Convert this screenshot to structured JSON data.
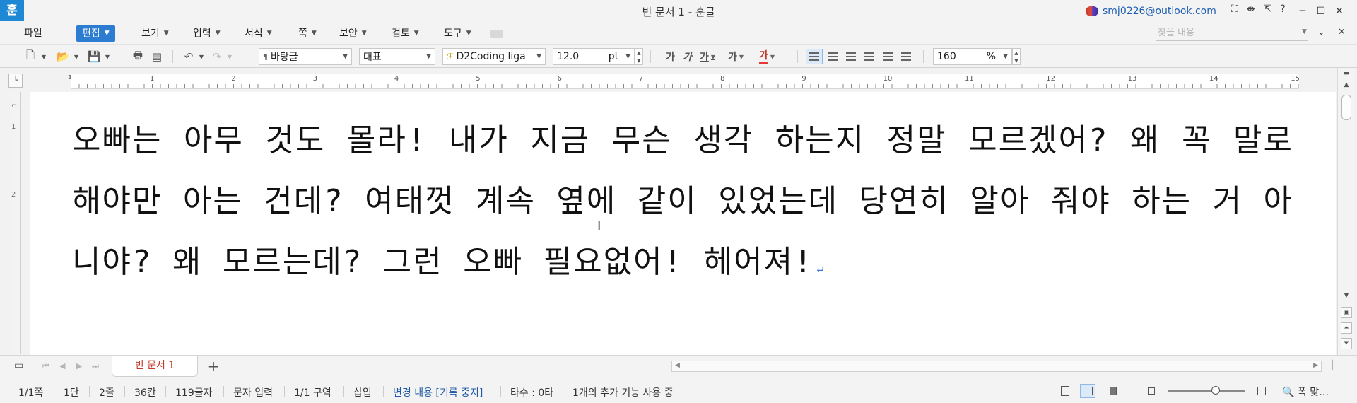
{
  "app": {
    "logo": "훈",
    "window_title": "빈 문서 1 - 훈글",
    "account_email": "smj0226@outlook.com",
    "help_label": "?"
  },
  "menu": {
    "items": [
      {
        "label": "파일",
        "has_dropdown": false
      },
      {
        "label": "편집",
        "has_dropdown": true,
        "active": true
      },
      {
        "label": "보기",
        "has_dropdown": true
      },
      {
        "label": "입력",
        "has_dropdown": true
      },
      {
        "label": "서식",
        "has_dropdown": true
      },
      {
        "label": "쪽",
        "has_dropdown": true
      },
      {
        "label": "보안",
        "has_dropdown": true
      },
      {
        "label": "검토",
        "has_dropdown": true
      },
      {
        "label": "도구",
        "has_dropdown": true
      }
    ],
    "find_placeholder": "찾을 내용"
  },
  "toolbar": {
    "style_name": "바탕글",
    "font_category": "대표",
    "font_name": "D2Coding liga",
    "font_size": "12.0",
    "font_size_unit": "pt",
    "format_buttons": [
      "가",
      "가",
      "가",
      "가",
      "가"
    ],
    "line_spacing": "160",
    "line_spacing_unit": "%",
    "accent_color": "#2c7cd1",
    "font_color_underline": "#e53935"
  },
  "ruler": {
    "marks": [
      "1",
      "2",
      "3",
      "4",
      "5",
      "6",
      "7",
      "8",
      "9",
      "10",
      "11",
      "12",
      "13",
      "14",
      "15"
    ],
    "vertical_marks": [
      "1",
      "2"
    ]
  },
  "document": {
    "text": "오빠는 아무 것도 몰라! 내가 지금 무슨 생각 하는지 정말 모르겠어? 왜 꼭 말로 해야만 아는 건데? 여태껏 계속 옆에 같이 있었는데 당연히 알아 줘야 하는 거 아니야? 왜 모르는데? 그런 오빠 필요없어! 헤어져!"
  },
  "tabs": {
    "document_tab": "빈 문서 1",
    "add_tab": "+"
  },
  "status": {
    "page": "1/1쪽",
    "column": "1단",
    "line": "2줄",
    "position": "36칸",
    "char_count": "119글자",
    "input_mode": "문자 입력",
    "section": "1/1 구역",
    "insert_mode": "삽입",
    "track_changes": "변경 내용 [기록 중지]",
    "typing_speed": "타수 : 0타",
    "addons": "1개의 추가 기능 사용 중",
    "fit": "폭 맞…",
    "zoom_fraction": 0.6
  }
}
